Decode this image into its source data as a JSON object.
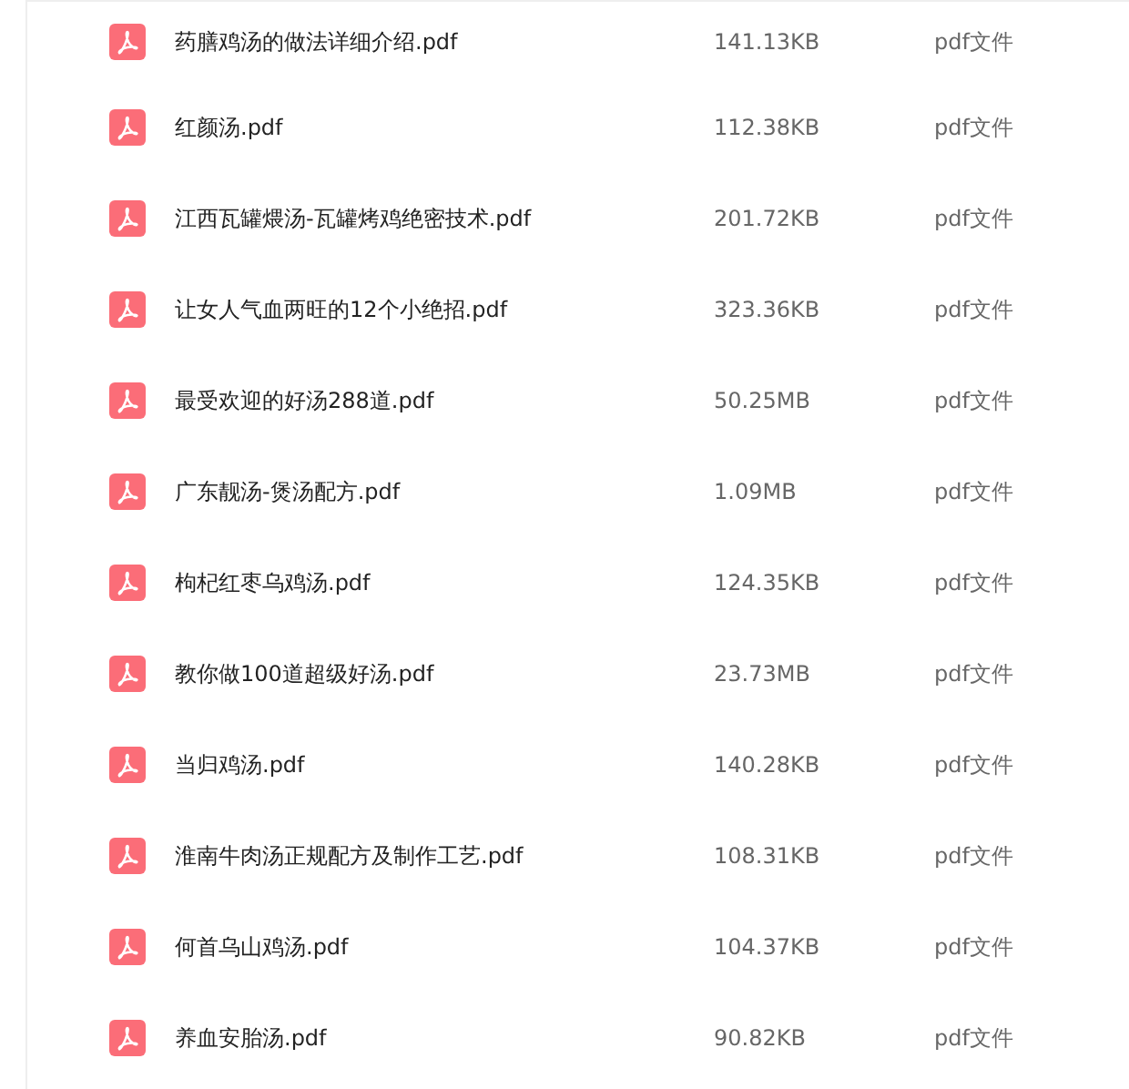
{
  "files": [
    {
      "name": "药膳鸡汤的做法详细介绍.pdf",
      "size": "141.13KB",
      "type": "pdf文件"
    },
    {
      "name": "红颜汤.pdf",
      "size": "112.38KB",
      "type": "pdf文件"
    },
    {
      "name": "江西瓦罐煨汤-瓦罐烤鸡绝密技术.pdf",
      "size": "201.72KB",
      "type": "pdf文件"
    },
    {
      "name": "让女人气血两旺的12个小绝招.pdf",
      "size": "323.36KB",
      "type": "pdf文件"
    },
    {
      "name": "最受欢迎的好汤288道.pdf",
      "size": "50.25MB",
      "type": "pdf文件"
    },
    {
      "name": "广东靓汤-煲汤配方.pdf",
      "size": "1.09MB",
      "type": "pdf文件"
    },
    {
      "name": "枸杞红枣乌鸡汤.pdf",
      "size": "124.35KB",
      "type": "pdf文件"
    },
    {
      "name": "教你做100道超级好汤.pdf",
      "size": "23.73MB",
      "type": "pdf文件"
    },
    {
      "name": "当归鸡汤.pdf",
      "size": "140.28KB",
      "type": "pdf文件"
    },
    {
      "name": "淮南牛肉汤正规配方及制作工艺.pdf",
      "size": "108.31KB",
      "type": "pdf文件"
    },
    {
      "name": "何首乌山鸡汤.pdf",
      "size": "104.37KB",
      "type": "pdf文件"
    },
    {
      "name": "养血安胎汤.pdf",
      "size": "90.82KB",
      "type": "pdf文件"
    }
  ]
}
